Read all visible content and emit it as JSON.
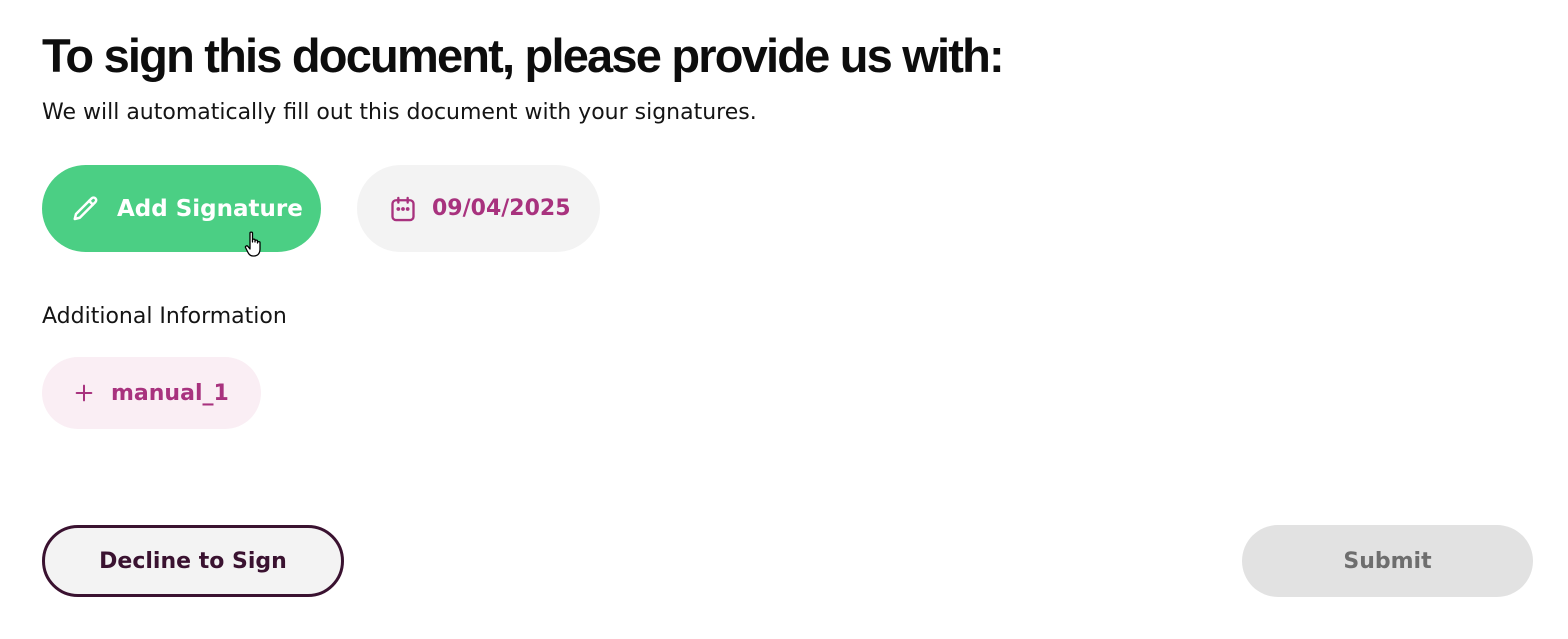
{
  "header": {
    "title": "To sign this document, please provide us with:",
    "subtitle": "We will automatically fill out this document with your signatures."
  },
  "actions": {
    "add_signature_label": "Add Signature",
    "add_signature_icon": "pencil-icon",
    "date_label": "09/04/2025",
    "date_icon": "calendar-icon"
  },
  "additional": {
    "section_label": "Additional Information",
    "manual_field_label": "manual_1",
    "manual_field_icon": "plus-icon"
  },
  "footer": {
    "decline_label": "Decline to Sign",
    "submit_label": "Submit",
    "submit_enabled": false
  },
  "colors": {
    "signature_button_bg": "#4bcf84",
    "accent_magenta": "#a8327e",
    "decline_border": "#3a1230",
    "submit_disabled_bg": "#e2e2e2"
  }
}
